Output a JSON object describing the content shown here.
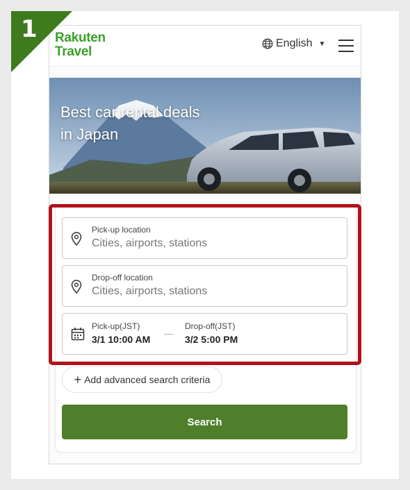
{
  "step": {
    "number": "1"
  },
  "header": {
    "logo_line1": "Rakuten",
    "logo_line2": "Travel",
    "language": "English",
    "icons": {
      "globe": "globe-icon",
      "caret": "caret-down-icon",
      "menu": "hamburger-menu-icon"
    }
  },
  "hero": {
    "title_line1": "Best car rental deals",
    "title_line2": "in Japan"
  },
  "search": {
    "pickup": {
      "label": "Pick-up location",
      "placeholder": "Cities, airports, stations",
      "icon": "location-pin-icon"
    },
    "dropoff": {
      "label": "Drop-off location",
      "placeholder": "Cities, airports, stations",
      "icon": "location-pin-icon"
    },
    "dates": {
      "icon": "calendar-icon",
      "pickup_label": "Pick-up(JST)",
      "pickup_value": "3/1 10:00 AM",
      "dropoff_label": "Drop-off(JST)",
      "dropoff_value": "3/2 5:00 PM"
    },
    "advanced": "Add advanced search criteria",
    "button": "Search"
  },
  "colors": {
    "brand_green": "#3aa02a",
    "button_green": "#4f7f2a",
    "corner_green": "#3f7a1f",
    "highlight_red": "#b0121b"
  }
}
